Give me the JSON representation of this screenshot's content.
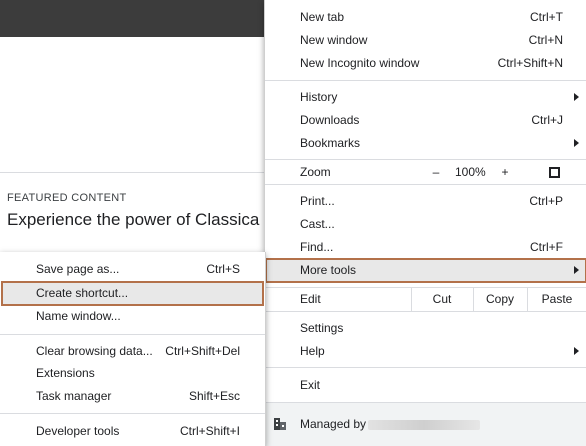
{
  "page": {
    "featured_label": "FEATURED CONTENT",
    "featured_title": "Experience the power of Classica"
  },
  "main_menu": {
    "new_tab": {
      "label": "New tab",
      "accel": "Ctrl+T"
    },
    "new_window": {
      "label": "New window",
      "accel": "Ctrl+N"
    },
    "new_incognito": {
      "label": "New Incognito window",
      "accel": "Ctrl+Shift+N"
    },
    "history": {
      "label": "History"
    },
    "downloads": {
      "label": "Downloads",
      "accel": "Ctrl+J"
    },
    "bookmarks": {
      "label": "Bookmarks"
    },
    "zoom": {
      "label": "Zoom",
      "minus": "–",
      "level": "100%",
      "plus": "+"
    },
    "print": {
      "label": "Print...",
      "accel": "Ctrl+P"
    },
    "cast": {
      "label": "Cast..."
    },
    "find": {
      "label": "Find...",
      "accel": "Ctrl+F"
    },
    "more_tools": {
      "label": "More tools"
    },
    "edit": {
      "label": "Edit",
      "cut": "Cut",
      "copy": "Copy",
      "paste": "Paste"
    },
    "settings": {
      "label": "Settings"
    },
    "help": {
      "label": "Help"
    },
    "exit": {
      "label": "Exit"
    },
    "managed_by": {
      "label": "Managed by"
    }
  },
  "sub_menu": {
    "save_page": {
      "label": "Save page as...",
      "accel": "Ctrl+S"
    },
    "create_shortcut": {
      "label": "Create shortcut..."
    },
    "name_window": {
      "label": "Name window..."
    },
    "clear_browsing": {
      "label": "Clear browsing data...",
      "accel": "Ctrl+Shift+Del"
    },
    "extensions": {
      "label": "Extensions"
    },
    "task_manager": {
      "label": "Task manager",
      "accel": "Shift+Esc"
    },
    "developer_tools": {
      "label": "Developer tools",
      "accel": "Ctrl+Shift+I"
    }
  },
  "icons": [
    "submenu-arrow-icon",
    "fullscreen-icon",
    "building-icon"
  ],
  "colors": {
    "highlight_outline": "#b3714a",
    "hover_bg": "#e8e8e8",
    "topbar": "#3c3c3c"
  }
}
